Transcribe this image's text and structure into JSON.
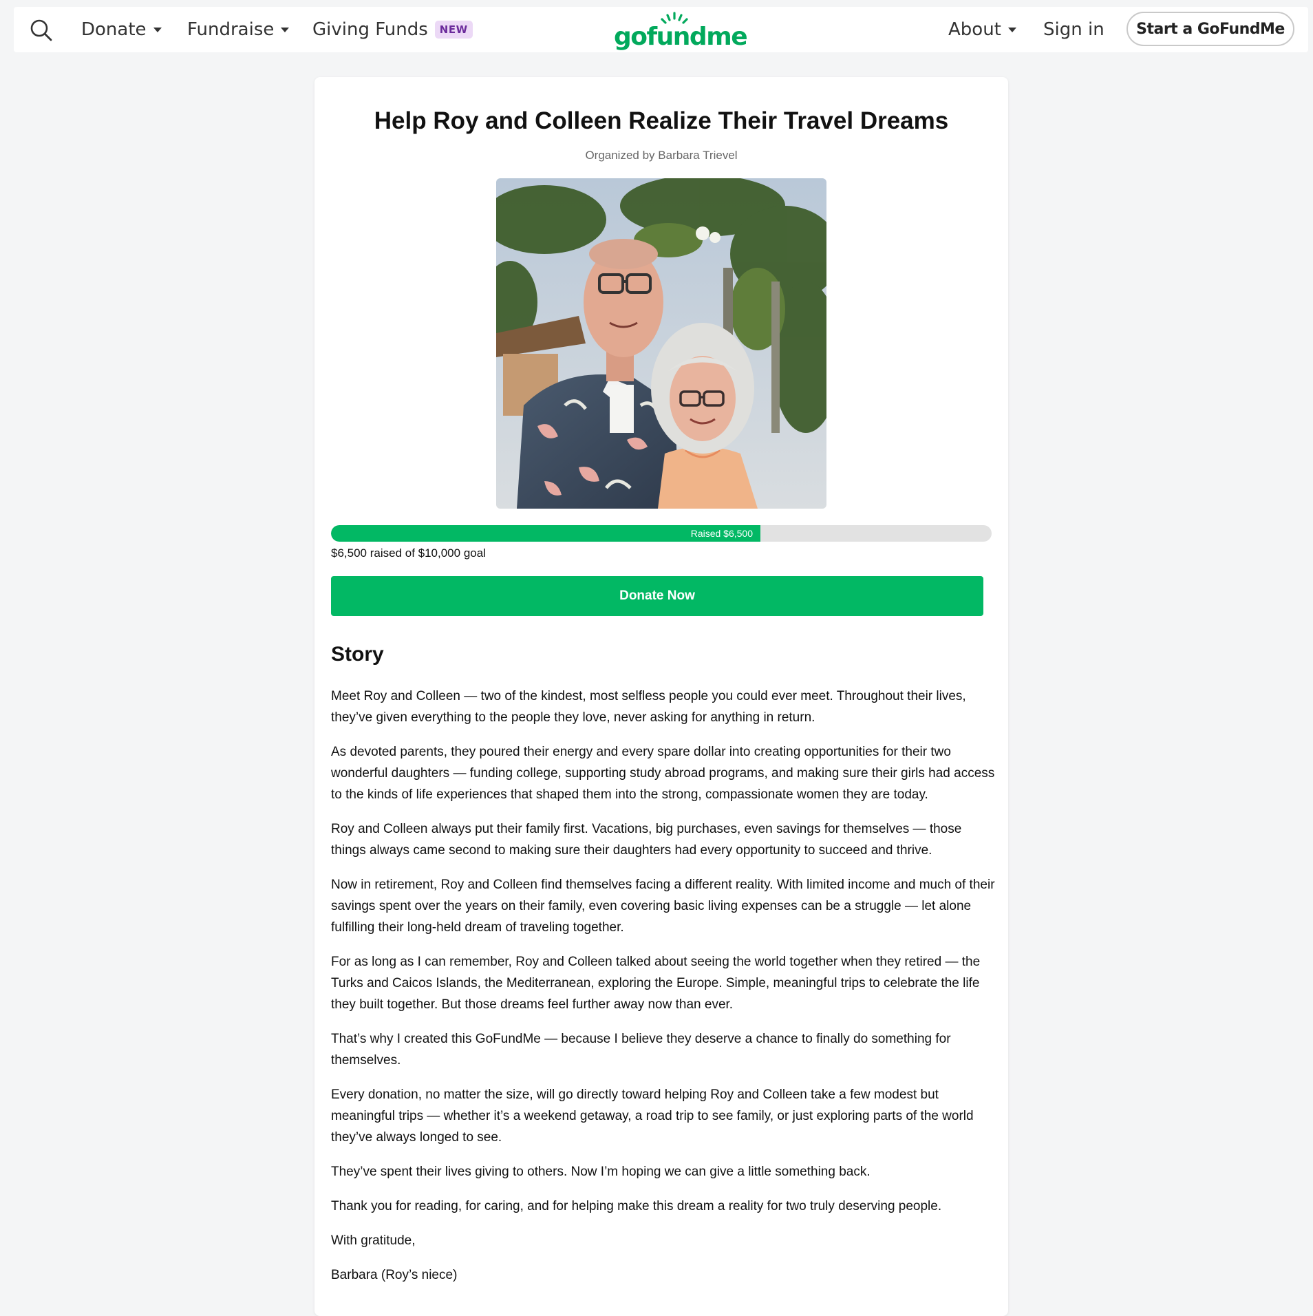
{
  "nav": {
    "donate": "Donate",
    "fundraise": "Fundraise",
    "giving_funds": "Giving Funds",
    "new_badge": "NEW",
    "logo": "gofundme",
    "about": "About",
    "sign_in": "Sign in",
    "start_button": "Start a GoFundMe"
  },
  "campaign": {
    "title": "Help Roy and Colleen Realize Their Travel Dreams",
    "organizer": "Organized by Barbara Trievel",
    "progress_label": "Raised $6,500",
    "progress_fraction": 0.65,
    "raised_text": "$6,500 raised of $10,000 goal",
    "donate_button": "Donate Now"
  },
  "colors": {
    "brand_green": "#02b864",
    "logo_green": "#02a95c",
    "new_badge_bg": "#ecd9f6",
    "new_badge_text": "#6b2b9b"
  },
  "story": {
    "heading": "Story",
    "paragraphs": [
      "Meet Roy and Colleen — two of the kindest, most selfless people you could ever meet. Throughout their lives, they’ve given everything to the people they love, never asking for anything in return.",
      "As devoted parents, they poured their energy and every spare dollar into creating opportunities for their two wonderful daughters — funding college, supporting study abroad programs, and making sure their girls had access to the kinds of life experiences that shaped them into the strong, compassionate women they are today.",
      "Roy and Colleen always put their family first. Vacations, big purchases, even savings for themselves — those things always came second to making sure their daughters had every opportunity to succeed and thrive.",
      "Now in retirement, Roy and Colleen find themselves facing a different reality. With limited income and much of their savings spent over the years on their family, even covering basic living expenses can be a struggle — let alone fulfilling their long-held dream of traveling together.",
      "For as long as I can remember, Roy and Colleen talked about seeing the world together when they retired — the Turks and Caicos Islands, the Mediterranean, exploring the Europe. Simple, meaningful trips to celebrate the life they built together. But those dreams feel further away now than ever.",
      "That’s why I created this GoFundMe — because I believe they deserve a chance to finally do something for themselves.",
      "Every donation, no matter the size, will go directly toward helping Roy and Colleen take a few modest but meaningful trips — whether it’s a weekend getaway, a road trip to see family, or just exploring parts of the world they’ve always longed to see.",
      "They’ve spent their lives giving to others. Now I’m hoping we can give a little something back.",
      "Thank you for reading, for caring, and for helping make this dream a reality for two truly deserving people.",
      "With gratitude,",
      "Barbara (Roy’s niece)"
    ]
  }
}
